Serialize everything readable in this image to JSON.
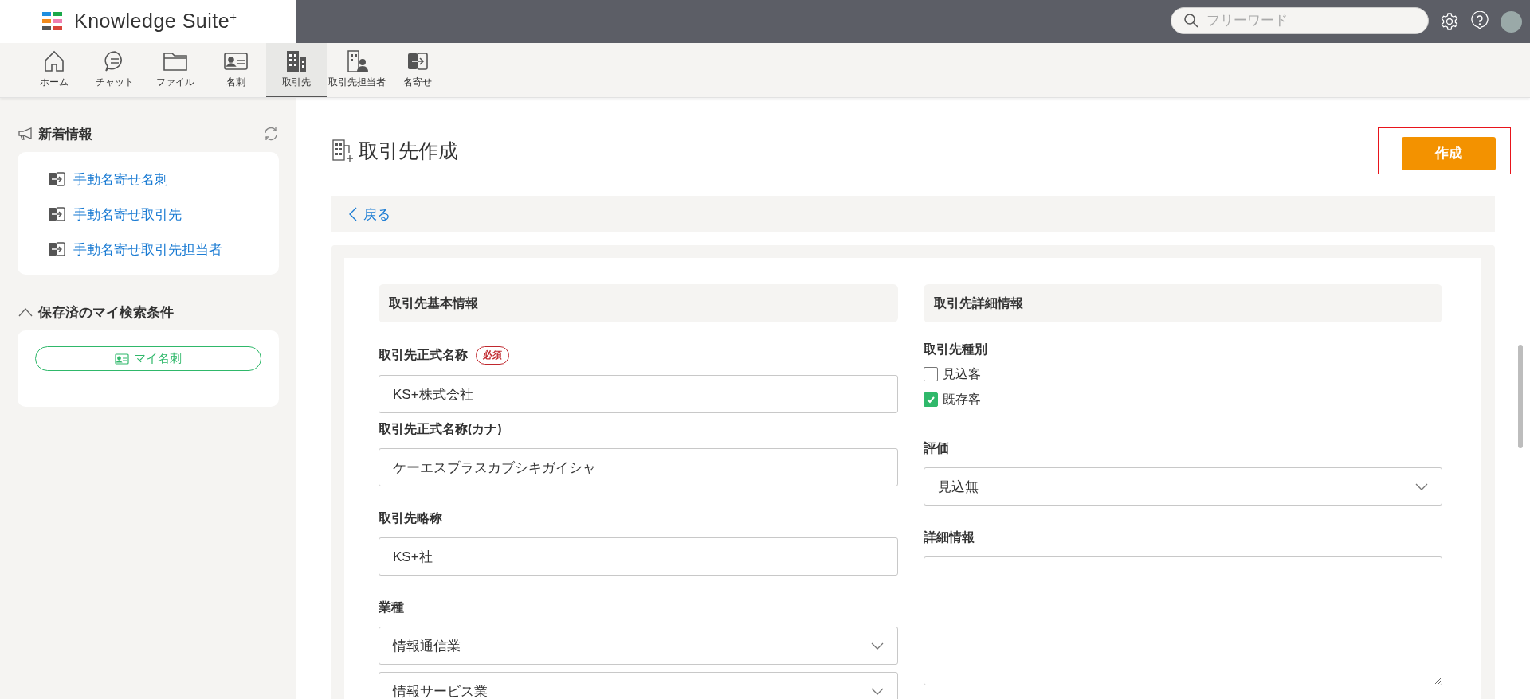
{
  "header": {
    "logo": "Knowledge Suite$^{+}$",
    "search": {
      "placeholder": "フリーワード"
    }
  },
  "nav": [
    {
      "label": "ホーム",
      "selected": false
    },
    {
      "label": "チャット",
      "selected": false
    },
    {
      "label": "ファイル",
      "selected": false
    },
    {
      "label": "名刺",
      "selected": false
    },
    {
      "label": "取引先",
      "selected": true
    },
    {
      "label": "取引先担当者",
      "selected": false
    },
    {
      "label": "名寄せ",
      "selected": false
    }
  ],
  "sidebar": {
    "news": {
      "title": "新着情報",
      "items": [
        "手動名寄せ名刺",
        "手動名寄せ取引先",
        "手動名寄せ取引先担当者"
      ]
    },
    "saved": {
      "title": "保存済のマイ検索条件",
      "expanded": true,
      "buttons": [
        "マイ名刺"
      ]
    }
  },
  "page": {
    "title": "取引先作成",
    "create_button": {
      "label": "作成",
      "highlighted": true
    },
    "back": "戻る"
  },
  "form": {
    "left": {
      "title": "取引先基本情報",
      "fields": [
        {
          "kind": "text",
          "label": "取引先正式名称",
          "badge": "必須",
          "value": "KS+株式会社"
        },
        {
          "kind": "text",
          "label": "取引先正式名称(カナ)",
          "value": "ケーエスプラスカブシキガイシャ"
        },
        {
          "kind": "text",
          "label": "取引先略称",
          "value": "KS+社"
        },
        {
          "kind": "select",
          "label": "業種",
          "values": [
            "情報通信業",
            "情報サービス業"
          ]
        }
      ]
    },
    "right": {
      "title": "取引先詳細情報",
      "fields": [
        {
          "kind": "checkboxes",
          "label": "取引先種別",
          "options": [
            {
              "label": "見込客",
              "checked": false
            },
            {
              "label": "既存客",
              "checked": true
            }
          ]
        },
        {
          "kind": "select",
          "label": "評価",
          "values": [
            "見込無"
          ]
        },
        {
          "kind": "textarea",
          "label": "詳細情報"
        }
      ]
    }
  }
}
